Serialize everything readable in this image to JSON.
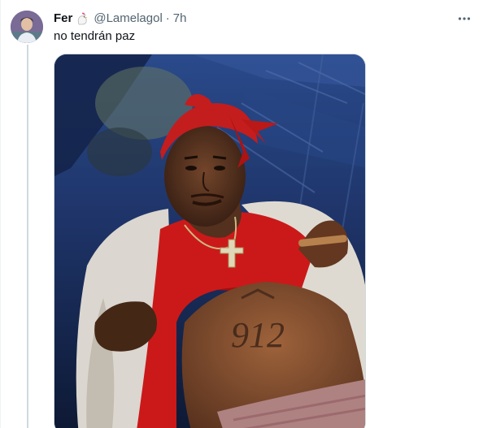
{
  "tweet": {
    "author_name": "Fer",
    "author_emoji_icon": "chicken-icon",
    "handle": "@Lamelagol",
    "separator": "·",
    "time": "7h",
    "text": "no tendrán paz",
    "more_icon": "more-horizontal-icon",
    "media": {
      "alt": "photo",
      "tattoo_text": "912"
    }
  },
  "colors": {
    "text_primary": "#0f1419",
    "text_secondary": "#536471",
    "thread_line": "#cfd9de"
  }
}
